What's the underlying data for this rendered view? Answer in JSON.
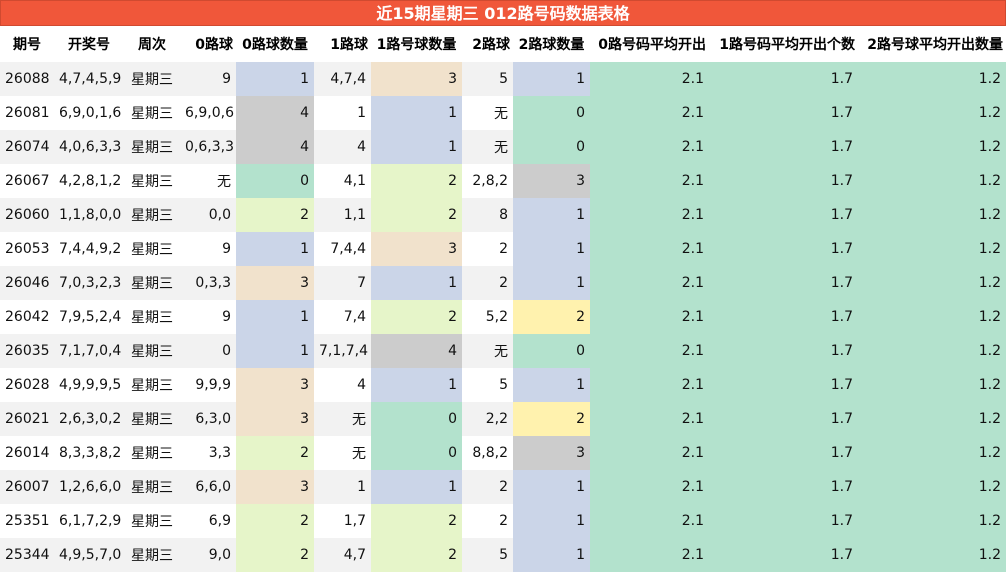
{
  "title": "近15期星期三 012路号码数据表格",
  "headers": [
    "期号",
    "开奖号",
    "周次",
    "0路球",
    "0路球数量",
    "1路球",
    "1路号球数量",
    "2路球",
    "2路球数量",
    "0路号码平均开出",
    "1路号码平均开出个数",
    "2路号球平均开出数量"
  ],
  "colors": {
    "blue": "#cbd5e8",
    "peach": "#f1e2cc",
    "green": "#b3e2cd",
    "lime": "#e6f5c9",
    "gray": "#cccccc",
    "yellow": "#fff2ae",
    "header_red": "#f0573a"
  },
  "rows": [
    {
      "issue": "26088",
      "draw": "4,7,4,5,9",
      "weekday": "星期三",
      "r0": "9",
      "r0_count": "1",
      "r1": "4,7,4",
      "r1_count": "3",
      "r2": "5",
      "r2_count": "1",
      "avg0": "2.1",
      "avg1": "1.7",
      "avg2": "1.2"
    },
    {
      "issue": "26081",
      "draw": "6,9,0,1,6",
      "weekday": "星期三",
      "r0": "6,9,0,6",
      "r0_count": "4",
      "r1": "1",
      "r1_count": "1",
      "r2": "无",
      "r2_count": "0",
      "avg0": "2.1",
      "avg1": "1.7",
      "avg2": "1.2"
    },
    {
      "issue": "26074",
      "draw": "4,0,6,3,3",
      "weekday": "星期三",
      "r0": "0,6,3,3",
      "r0_count": "4",
      "r1": "4",
      "r1_count": "1",
      "r2": "无",
      "r2_count": "0",
      "avg0": "2.1",
      "avg1": "1.7",
      "avg2": "1.2"
    },
    {
      "issue": "26067",
      "draw": "4,2,8,1,2",
      "weekday": "星期三",
      "r0": "无",
      "r0_count": "0",
      "r1": "4,1",
      "r1_count": "2",
      "r2": "2,8,2",
      "r2_count": "3",
      "avg0": "2.1",
      "avg1": "1.7",
      "avg2": "1.2"
    },
    {
      "issue": "26060",
      "draw": "1,1,8,0,0",
      "weekday": "星期三",
      "r0": "0,0",
      "r0_count": "2",
      "r1": "1,1",
      "r1_count": "2",
      "r2": "8",
      "r2_count": "1",
      "avg0": "2.1",
      "avg1": "1.7",
      "avg2": "1.2"
    },
    {
      "issue": "26053",
      "draw": "7,4,4,9,2",
      "weekday": "星期三",
      "r0": "9",
      "r0_count": "1",
      "r1": "7,4,4",
      "r1_count": "3",
      "r2": "2",
      "r2_count": "1",
      "avg0": "2.1",
      "avg1": "1.7",
      "avg2": "1.2"
    },
    {
      "issue": "26046",
      "draw": "7,0,3,2,3",
      "weekday": "星期三",
      "r0": "0,3,3",
      "r0_count": "3",
      "r1": "7",
      "r1_count": "1",
      "r2": "2",
      "r2_count": "1",
      "avg0": "2.1",
      "avg1": "1.7",
      "avg2": "1.2"
    },
    {
      "issue": "26042",
      "draw": "7,9,5,2,4",
      "weekday": "星期三",
      "r0": "9",
      "r0_count": "1",
      "r1": "7,4",
      "r1_count": "2",
      "r2": "5,2",
      "r2_count": "2",
      "avg0": "2.1",
      "avg1": "1.7",
      "avg2": "1.2"
    },
    {
      "issue": "26035",
      "draw": "7,1,7,0,4",
      "weekday": "星期三",
      "r0": "0",
      "r0_count": "1",
      "r1": "7,1,7,4",
      "r1_count": "4",
      "r2": "无",
      "r2_count": "0",
      "avg0": "2.1",
      "avg1": "1.7",
      "avg2": "1.2"
    },
    {
      "issue": "26028",
      "draw": "4,9,9,9,5",
      "weekday": "星期三",
      "r0": "9,9,9",
      "r0_count": "3",
      "r1": "4",
      "r1_count": "1",
      "r2": "5",
      "r2_count": "1",
      "avg0": "2.1",
      "avg1": "1.7",
      "avg2": "1.2"
    },
    {
      "issue": "26021",
      "draw": "2,6,3,0,2",
      "weekday": "星期三",
      "r0": "6,3,0",
      "r0_count": "3",
      "r1": "无",
      "r1_count": "0",
      "r2": "2,2",
      "r2_count": "2",
      "avg0": "2.1",
      "avg1": "1.7",
      "avg2": "1.2"
    },
    {
      "issue": "26014",
      "draw": "8,3,3,8,2",
      "weekday": "星期三",
      "r0": "3,3",
      "r0_count": "2",
      "r1": "无",
      "r1_count": "0",
      "r2": "8,8,2",
      "r2_count": "3",
      "avg0": "2.1",
      "avg1": "1.7",
      "avg2": "1.2"
    },
    {
      "issue": "26007",
      "draw": "1,2,6,6,0",
      "weekday": "星期三",
      "r0": "6,6,0",
      "r0_count": "3",
      "r1": "1",
      "r1_count": "1",
      "r2": "2",
      "r2_count": "1",
      "avg0": "2.1",
      "avg1": "1.7",
      "avg2": "1.2"
    },
    {
      "issue": "25351",
      "draw": "6,1,7,2,9",
      "weekday": "星期三",
      "r0": "6,9",
      "r0_count": "2",
      "r1": "1,7",
      "r1_count": "2",
      "r2": "2",
      "r2_count": "1",
      "avg0": "2.1",
      "avg1": "1.7",
      "avg2": "1.2"
    },
    {
      "issue": "25344",
      "draw": "4,9,5,7,0",
      "weekday": "星期三",
      "r0": "9,0",
      "r0_count": "2",
      "r1": "4,7",
      "r1_count": "2",
      "r2": "5",
      "r2_count": "1",
      "avg0": "2.1",
      "avg1": "1.7",
      "avg2": "1.2"
    }
  ]
}
